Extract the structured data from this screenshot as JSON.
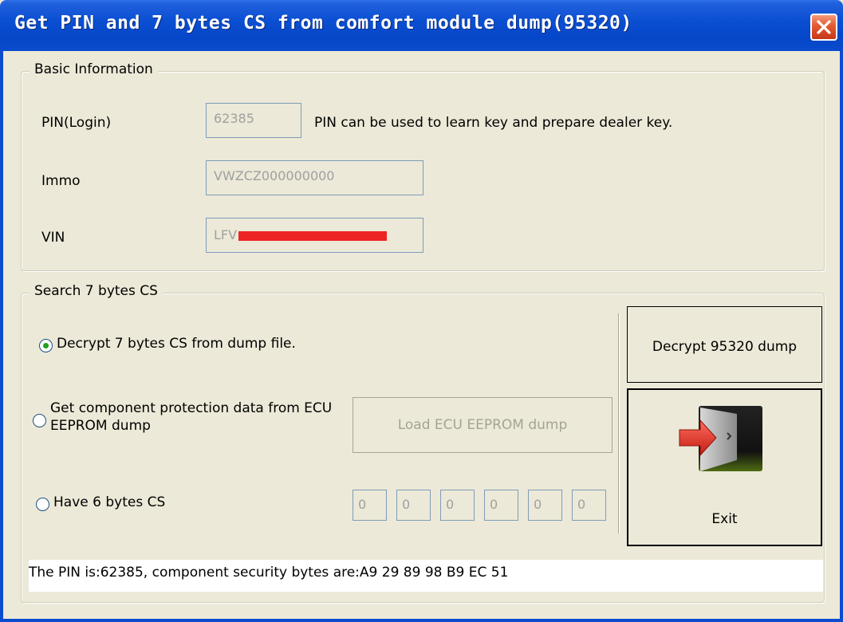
{
  "window": {
    "title": "Get PIN and 7 bytes CS from comfort module dump(95320)"
  },
  "basic_info": {
    "legend": "Basic Information",
    "pin_label": "PIN(Login)",
    "pin_value": "62385",
    "pin_hint": "PIN can be used to learn key and prepare dealer key.",
    "immo_label": "Immo",
    "immo_value": "VWZCZ000000000",
    "vin_label": "VIN",
    "vin_value_prefix": "LFV"
  },
  "search_cs": {
    "legend": "Search 7 bytes CS",
    "options": [
      {
        "label": "Decrypt 7 bytes CS from dump file.",
        "selected": true
      },
      {
        "label": "Get component protection data from ECU EEPROM dump",
        "selected": false
      },
      {
        "label": "Have 6 bytes CS",
        "selected": false
      }
    ],
    "load_button": "Load ECU EEPROM dump",
    "cs_bytes": [
      "0",
      "0",
      "0",
      "0",
      "0",
      "0"
    ],
    "decrypt_button": "Decrypt 95320 dump",
    "exit_button": "Exit"
  },
  "status": {
    "text": "The PIN is:62385, component security bytes are:A9 29 89 98 B9 EC 51"
  },
  "colors": {
    "title_bar": "#0a4ccd",
    "window_bg": "#ece9d8",
    "close_button": "#e25a2f",
    "radio_selected": "#21a121",
    "redaction": "#ee2424"
  },
  "icons": [
    "close-icon",
    "exit-door-icon"
  ]
}
